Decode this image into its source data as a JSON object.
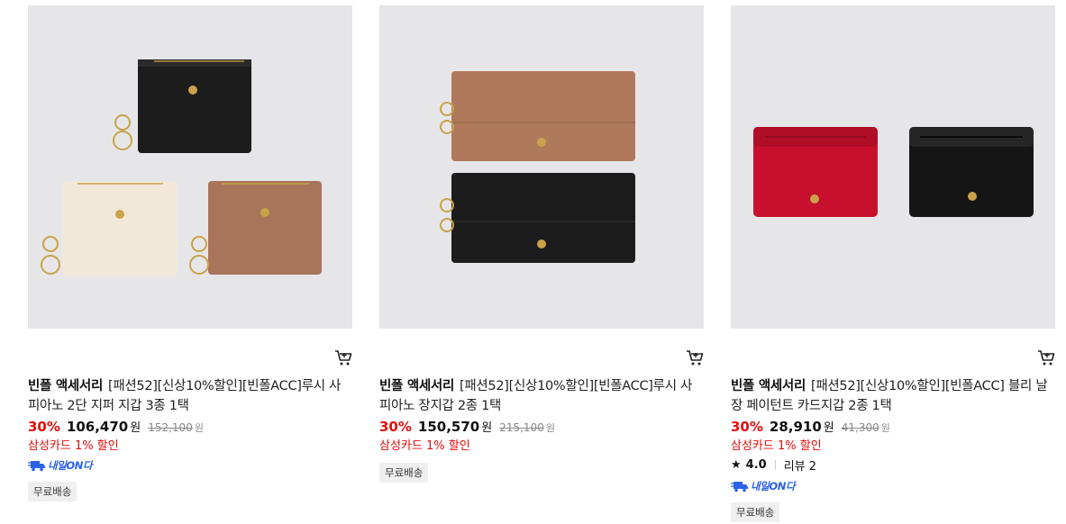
{
  "products": [
    {
      "brand": "빈폴 액세서리",
      "title": "[패션52][신상10%할인][빈폴ACC]루시 사피아노 2단 지퍼 지갑 3종 1택",
      "discount_rate": "30%",
      "price": "106,470",
      "currency": "원",
      "original_price": "152,100",
      "card_discount": "삼성카드 1% 할인",
      "delivery_badge": "내일ON다",
      "shipping": "무료배송"
    },
    {
      "brand": "빈폴 액세서리",
      "title": "[패션52][신상10%할인][빈폴ACC]루시 사피아노 장지갑 2종 1택",
      "discount_rate": "30%",
      "price": "150,570",
      "currency": "원",
      "original_price": "215,100",
      "card_discount": "삼성카드 1% 할인",
      "shipping": "무료배송"
    },
    {
      "brand": "빈폴 액세서리",
      "title": "[패션52][신상10%할인][빈폴ACC] 블리 날장 페이턴트 카드지갑 2종 1택",
      "discount_rate": "30%",
      "price": "28,910",
      "currency": "원",
      "original_price": "41,300",
      "card_discount": "삼성카드 1% 할인",
      "rating": "4.0",
      "review_label": "리뷰 2",
      "delivery_badge": "내일ON다",
      "shipping": "무료배송"
    }
  ],
  "icons": {
    "cart": "cart-icon",
    "star": "star-icon",
    "delivery": "delivery-truck-icon"
  },
  "colors": {
    "discount": "#e50b0b",
    "badge": "#2a63e8",
    "thumb_bg": "#e6e6e8"
  }
}
